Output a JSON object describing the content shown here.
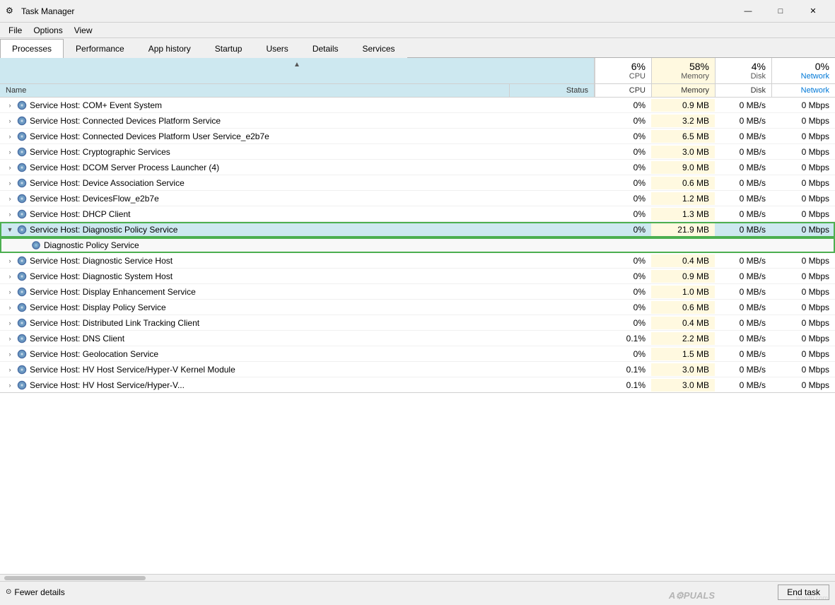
{
  "titleBar": {
    "title": "Task Manager",
    "icon": "⚙",
    "minimize": "—",
    "maximize": "□",
    "close": "✕"
  },
  "menuBar": {
    "items": [
      "File",
      "Options",
      "View"
    ]
  },
  "tabs": [
    {
      "label": "Processes",
      "active": true
    },
    {
      "label": "Performance",
      "active": false
    },
    {
      "label": "App history",
      "active": false
    },
    {
      "label": "Startup",
      "active": false
    },
    {
      "label": "Users",
      "active": false
    },
    {
      "label": "Details",
      "active": false
    },
    {
      "label": "Services",
      "active": false
    }
  ],
  "columns": {
    "cpu_pct": "6%",
    "cpu_label": "CPU",
    "mem_pct": "58%",
    "mem_label": "Memory",
    "disk_pct": "4%",
    "disk_label": "Disk",
    "net_pct": "0%",
    "net_label": "Network",
    "name_label": "Name",
    "status_label": "Status"
  },
  "rows": [
    {
      "indent": 0,
      "expand": ">",
      "name": "Service Host: COM+ Event System",
      "status": "",
      "cpu": "0%",
      "memory": "0.9 MB",
      "disk": "0 MB/s",
      "network": "0 Mbps",
      "selected": false,
      "highlighted": false,
      "child": false
    },
    {
      "indent": 0,
      "expand": ">",
      "name": "Service Host: Connected Devices Platform Service",
      "status": "",
      "cpu": "0%",
      "memory": "3.2 MB",
      "disk": "0 MB/s",
      "network": "0 Mbps",
      "selected": false,
      "highlighted": false,
      "child": false
    },
    {
      "indent": 0,
      "expand": ">",
      "name": "Service Host: Connected Devices Platform User Service_e2b7e",
      "status": "",
      "cpu": "0%",
      "memory": "6.5 MB",
      "disk": "0 MB/s",
      "network": "0 Mbps",
      "selected": false,
      "highlighted": false,
      "child": false
    },
    {
      "indent": 0,
      "expand": ">",
      "name": "Service Host: Cryptographic Services",
      "status": "",
      "cpu": "0%",
      "memory": "3.0 MB",
      "disk": "0 MB/s",
      "network": "0 Mbps",
      "selected": false,
      "highlighted": false,
      "child": false
    },
    {
      "indent": 0,
      "expand": ">",
      "name": "Service Host: DCOM Server Process Launcher (4)",
      "status": "",
      "cpu": "0%",
      "memory": "9.0 MB",
      "disk": "0 MB/s",
      "network": "0 Mbps",
      "selected": false,
      "highlighted": false,
      "child": false
    },
    {
      "indent": 0,
      "expand": ">",
      "name": "Service Host: Device Association Service",
      "status": "",
      "cpu": "0%",
      "memory": "0.6 MB",
      "disk": "0 MB/s",
      "network": "0 Mbps",
      "selected": false,
      "highlighted": false,
      "child": false
    },
    {
      "indent": 0,
      "expand": ">",
      "name": "Service Host: DevicesFlow_e2b7e",
      "status": "",
      "cpu": "0%",
      "memory": "1.2 MB",
      "disk": "0 MB/s",
      "network": "0 Mbps",
      "selected": false,
      "highlighted": false,
      "child": false
    },
    {
      "indent": 0,
      "expand": ">",
      "name": "Service Host: DHCP Client",
      "status": "",
      "cpu": "0%",
      "memory": "1.3 MB",
      "disk": "0 MB/s",
      "network": "0 Mbps",
      "selected": false,
      "highlighted": false,
      "child": false
    },
    {
      "indent": 0,
      "expand": "v",
      "name": "Service Host: Diagnostic Policy Service",
      "status": "",
      "cpu": "0%",
      "memory": "21.9 MB",
      "disk": "0 MB/s",
      "network": "0 Mbps",
      "selected": true,
      "highlighted": true,
      "child": false
    },
    {
      "indent": 1,
      "expand": "",
      "name": "Diagnostic Policy Service",
      "status": "",
      "cpu": "",
      "memory": "",
      "disk": "",
      "network": "",
      "selected": true,
      "highlighted": true,
      "child": true
    },
    {
      "indent": 0,
      "expand": ">",
      "name": "Service Host: Diagnostic Service Host",
      "status": "",
      "cpu": "0%",
      "memory": "0.4 MB",
      "disk": "0 MB/s",
      "network": "0 Mbps",
      "selected": false,
      "highlighted": false,
      "child": false
    },
    {
      "indent": 0,
      "expand": ">",
      "name": "Service Host: Diagnostic System Host",
      "status": "",
      "cpu": "0%",
      "memory": "0.9 MB",
      "disk": "0 MB/s",
      "network": "0 Mbps",
      "selected": false,
      "highlighted": false,
      "child": false
    },
    {
      "indent": 0,
      "expand": ">",
      "name": "Service Host: Display Enhancement Service",
      "status": "",
      "cpu": "0%",
      "memory": "1.0 MB",
      "disk": "0 MB/s",
      "network": "0 Mbps",
      "selected": false,
      "highlighted": false,
      "child": false
    },
    {
      "indent": 0,
      "expand": ">",
      "name": "Service Host: Display Policy Service",
      "status": "",
      "cpu": "0%",
      "memory": "0.6 MB",
      "disk": "0 MB/s",
      "network": "0 Mbps",
      "selected": false,
      "highlighted": false,
      "child": false
    },
    {
      "indent": 0,
      "expand": ">",
      "name": "Service Host: Distributed Link Tracking Client",
      "status": "",
      "cpu": "0%",
      "memory": "0.4 MB",
      "disk": "0 MB/s",
      "network": "0 Mbps",
      "selected": false,
      "highlighted": false,
      "child": false
    },
    {
      "indent": 0,
      "expand": ">",
      "name": "Service Host: DNS Client",
      "status": "",
      "cpu": "0.1%",
      "memory": "2.2 MB",
      "disk": "0 MB/s",
      "network": "0 Mbps",
      "selected": false,
      "highlighted": false,
      "child": false
    },
    {
      "indent": 0,
      "expand": ">",
      "name": "Service Host: Geolocation Service",
      "status": "",
      "cpu": "0%",
      "memory": "1.5 MB",
      "disk": "0 MB/s",
      "network": "0 Mbps",
      "selected": false,
      "highlighted": false,
      "child": false
    },
    {
      "indent": 0,
      "expand": ">",
      "name": "Service Host: HV Host Service/Hyper-V Kernel Module",
      "status": "",
      "cpu": "0.1%",
      "memory": "3.0 MB",
      "disk": "0 MB/s",
      "network": "0 Mbps",
      "selected": false,
      "highlighted": false,
      "child": false
    }
  ],
  "bottomBar": {
    "fewer_details": "Fewer details",
    "end_task": "End task"
  }
}
